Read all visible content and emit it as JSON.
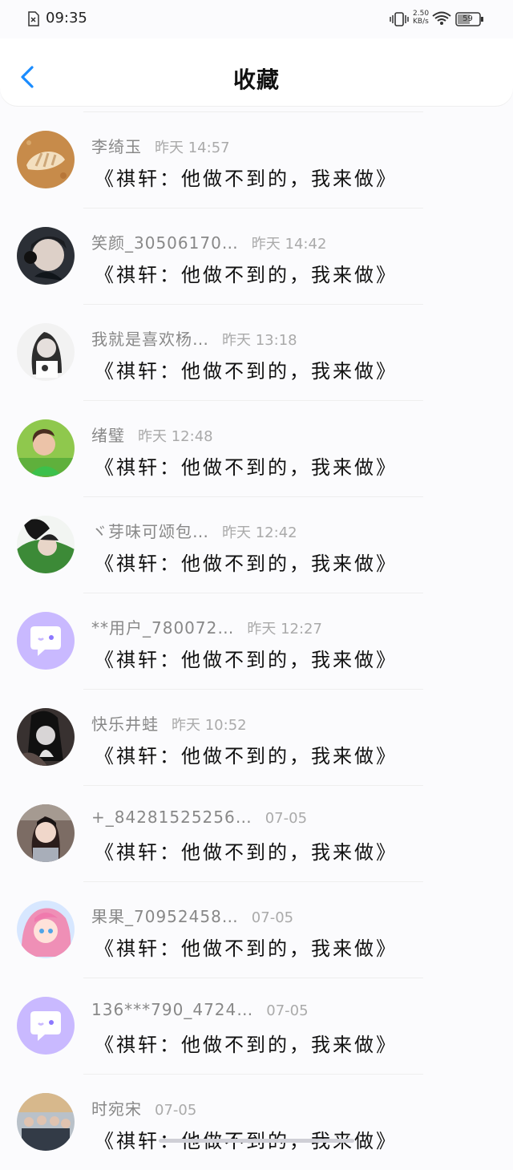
{
  "status": {
    "time": "09:35",
    "net_speed": "2.50\nKB/s",
    "battery": "59"
  },
  "header": {
    "title": "收藏"
  },
  "items": [
    {
      "name": "李绮玉",
      "time": "昨天 14:57",
      "title": "《祺轩：他做不到的，我来做》",
      "avatar": "shell"
    },
    {
      "name": "笑颜_30506170…",
      "time": "昨天 14:42",
      "title": "《祺轩：他做不到的，我来做》",
      "avatar": "boy-headphones"
    },
    {
      "name": "我就是喜欢杨…",
      "time": "昨天 13:18",
      "title": "《祺轩：他做不到的，我来做》",
      "avatar": "girl-bw"
    },
    {
      "name": "绪璧",
      "time": "昨天 12:48",
      "title": "《祺轩：他做不到的，我来做》",
      "avatar": "boy-green"
    },
    {
      "name": "ヾ芽味可颂包…",
      "time": "昨天 12:42",
      "title": "《祺轩：他做不到的，我来做》",
      "avatar": "green-jacket"
    },
    {
      "name": "**用户_780072…",
      "time": "昨天 12:27",
      "title": "《祺轩：他做不到的，我来做》",
      "avatar": "default"
    },
    {
      "name": "快乐井蛙",
      "time": "昨天 10:52",
      "title": "《祺轩：他做不到的，我来做》",
      "avatar": "dark-photo"
    },
    {
      "name": "+_84281525256…",
      "time": "07-05",
      "title": "《祺轩：他做不到的，我来做》",
      "avatar": "girl-room"
    },
    {
      "name": "果果_70952458…",
      "time": "07-05",
      "title": "《祺轩：他做不到的，我来做》",
      "avatar": "anime"
    },
    {
      "name": "136***790_4724…",
      "time": "07-05",
      "title": "《祺轩：他做不到的，我来做》",
      "avatar": "default"
    },
    {
      "name": "时宛宋",
      "time": "07-05",
      "title": "《祺轩：他做不到的，我来做》",
      "avatar": "group"
    }
  ]
}
